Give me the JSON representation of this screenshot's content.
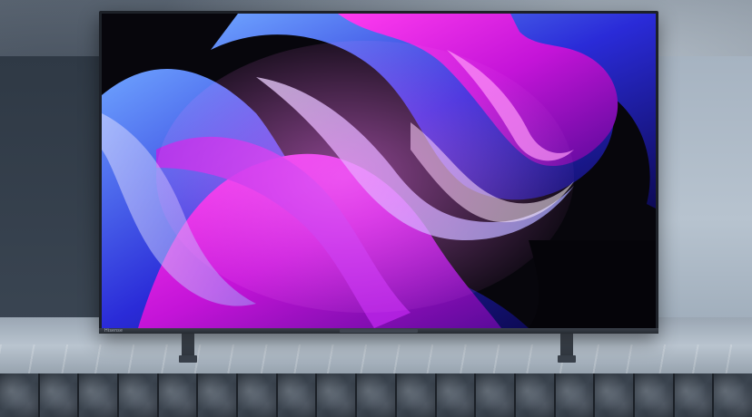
{
  "tv": {
    "brand_label": "Hisense"
  },
  "colors": {
    "accent_magenta": "#e01ce0",
    "accent_blue": "#2a2bd8",
    "screen_black": "#07060c",
    "bezel": "#1d2128",
    "wall": "#7e8893",
    "marble": "#2f3640"
  },
  "icons": {
    "stand": "tv-stand-foot"
  }
}
